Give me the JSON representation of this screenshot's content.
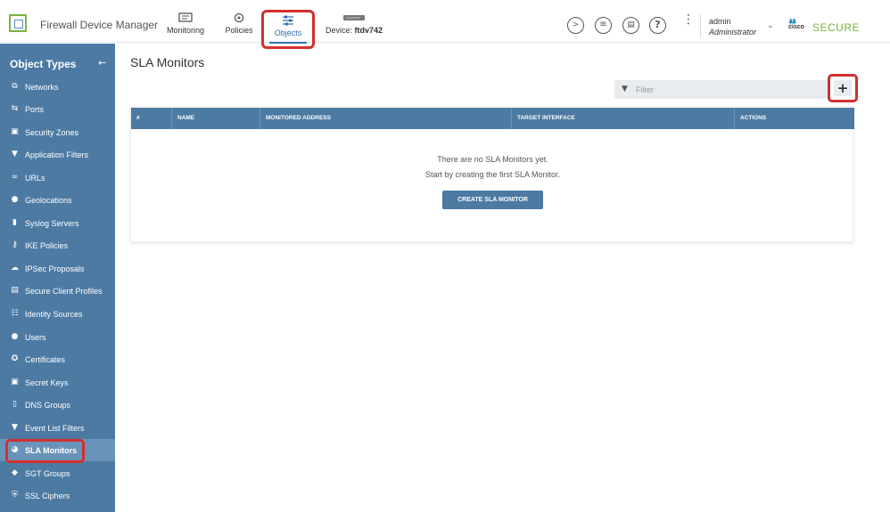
{
  "header": {
    "app_title": "Firewall Device Manager",
    "nav": {
      "monitoring": "Monitoring",
      "policies": "Policies",
      "objects": "Objects",
      "device_prefix": "Device:",
      "device_name": "ftdv742"
    },
    "icons": [
      "cli-console-icon",
      "deployment-icon",
      "task-list-icon",
      "help-icon",
      "more-options-icon"
    ],
    "user": {
      "name": "admin",
      "role": "Administrator"
    },
    "brand": {
      "cisco": "cisco",
      "secure": "SECURE"
    }
  },
  "sidebar": {
    "title": "Object Types",
    "items": [
      {
        "label": "Networks",
        "icon": "networks-icon"
      },
      {
        "label": "Ports",
        "icon": "ports-icon"
      },
      {
        "label": "Security Zones",
        "icon": "lock-icon"
      },
      {
        "label": "Application Filters",
        "icon": "application-filter-icon"
      },
      {
        "label": "URLs",
        "icon": "link-icon"
      },
      {
        "label": "Geolocations",
        "icon": "location-pin-icon"
      },
      {
        "label": "Syslog Servers",
        "icon": "server-icon"
      },
      {
        "label": "IKE Policies",
        "icon": "key-icon"
      },
      {
        "label": "IPSec Proposals",
        "icon": "cloud-lock-icon"
      },
      {
        "label": "Secure Client Profiles",
        "icon": "document-icon"
      },
      {
        "label": "Identity Sources",
        "icon": "identity-icon"
      },
      {
        "label": "Users",
        "icon": "user-icon"
      },
      {
        "label": "Certificates",
        "icon": "certificate-icon"
      },
      {
        "label": "Secret Keys",
        "icon": "lock-icon"
      },
      {
        "label": "DNS Groups",
        "icon": "dns-icon"
      },
      {
        "label": "Event List Filters",
        "icon": "filter-icon"
      },
      {
        "label": "SLA Monitors",
        "icon": "gauge-icon"
      },
      {
        "label": "SGT Groups",
        "icon": "tag-icon"
      },
      {
        "label": "SSL Ciphers",
        "icon": "shield-icon"
      }
    ],
    "active_index": 16
  },
  "main": {
    "title": "SLA Monitors",
    "filter_placeholder": "Filter",
    "add_label": "+",
    "table": {
      "columns": [
        "#",
        "NAME",
        "MONITORED ADDRESS",
        "TARGET INTERFACE",
        "ACTIONS"
      ]
    },
    "empty_message": "There are no SLA Monitors yet.",
    "empty_hint": "Start by creating the first SLA Monitor.",
    "create_button": "CREATE SLA MONITOR"
  },
  "colors": {
    "sidebar_bg": "#4c7aa3",
    "accent_blue": "#2f6fb0",
    "highlight_red": "#d32f2f",
    "brand_green": "#7cb342"
  }
}
